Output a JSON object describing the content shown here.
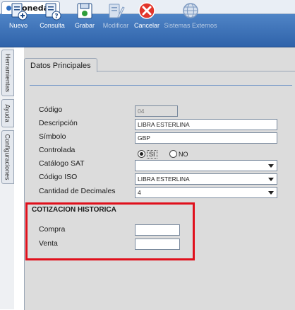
{
  "window": {
    "tab_title": "Monedas"
  },
  "toolbar": {
    "buttons": [
      {
        "label": "Nuevo",
        "icon": "new-icon",
        "enabled": true
      },
      {
        "label": "Consulta",
        "icon": "query-icon",
        "enabled": true
      },
      {
        "label": "Grabar",
        "icon": "save-icon",
        "enabled": true
      },
      {
        "label": "Modificar",
        "icon": "edit-icon",
        "enabled": false
      },
      {
        "label": "Cancelar",
        "icon": "cancel-icon",
        "enabled": true
      },
      {
        "label": "Sistemas Externos",
        "icon": "globe-icon",
        "enabled": false
      }
    ]
  },
  "side_tabs": [
    "Herramientas",
    "Ayuda",
    "Configuraciones"
  ],
  "panel_tab": "Datos Principales",
  "form": {
    "codigo": {
      "label": "Código",
      "value": "04"
    },
    "descripcion": {
      "label": "Descripción",
      "value": "LIBRA ESTERLINA"
    },
    "simbolo": {
      "label": "Símbolo",
      "value": "GBP"
    },
    "controlada": {
      "label": "Controlada",
      "opt_si": "SI",
      "opt_no": "NO",
      "selected": "SI"
    },
    "catalogo_sat": {
      "label": "Catálogo SAT",
      "value": ""
    },
    "codigo_iso": {
      "label": "Código ISO",
      "value": "LIBRA ESTERLINA"
    },
    "decimales": {
      "label": "Cantidad de Decimales",
      "value": "4"
    }
  },
  "cotizacion": {
    "title": "COTIZACION HISTORICA",
    "compra": {
      "label": "Compra",
      "value": ""
    },
    "venta": {
      "label": "Venta",
      "value": ""
    }
  },
  "colors": {
    "toolbar": "#3a70b8",
    "highlight": "#e0101c",
    "panel": "#dcdcdc"
  }
}
